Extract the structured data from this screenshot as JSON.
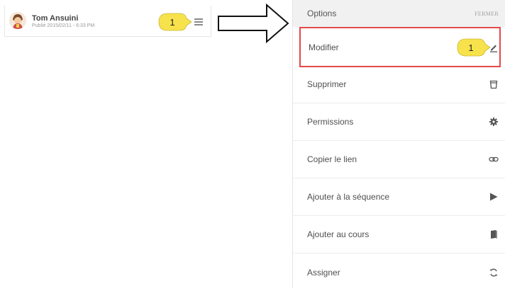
{
  "post": {
    "author": "Tom Ansuini",
    "date": "Publié 2015/02/11 - 6:33 PM"
  },
  "callouts": {
    "left": "1",
    "right": "1"
  },
  "panel": {
    "title": "Options",
    "close_label": "FERMER",
    "items": [
      {
        "label": "Modifier",
        "icon": "pencil-icon"
      },
      {
        "label": "Supprimer",
        "icon": "trash-icon"
      },
      {
        "label": "Permissions",
        "icon": "gear-icon"
      },
      {
        "label": "Copier le lien",
        "icon": "link-icon"
      },
      {
        "label": "Ajouter à la séquence",
        "icon": "play-plus-icon"
      },
      {
        "label": "Ajouter au cours",
        "icon": "book-icon"
      },
      {
        "label": "Assigner",
        "icon": "refresh-icon"
      }
    ]
  },
  "colors": {
    "callout_fill": "#f7e24b",
    "highlight_border": "#e24a4a",
    "header_bg": "#f1f1f1"
  }
}
